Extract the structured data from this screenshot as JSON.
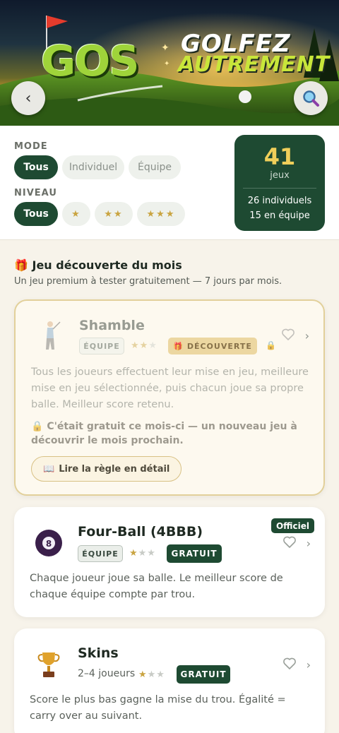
{
  "hero": {
    "logo": "GOS",
    "tagline_1": "GOLFEZ",
    "tagline_2": "AUTREMENT",
    "back_icon": "chevron-left-icon",
    "search_icon": "search-icon"
  },
  "filters": {
    "mode_label": "MODE",
    "mode_options": [
      "Tous",
      "Individuel",
      "Équipe"
    ],
    "mode_selected": "Tous",
    "level_label": "NIVEAU",
    "level_options": [
      "Tous",
      "★",
      "★★",
      "★★★"
    ],
    "level_selected": "Tous"
  },
  "summary": {
    "count": "41",
    "unit": "jeux",
    "individual": "26 individuels",
    "team": "15 en équipe"
  },
  "discovery": {
    "title": "Jeu découverte du mois",
    "subtitle": "Un jeu premium à tester gratuitement — 7 jours par mois."
  },
  "games": [
    {
      "name": "Shamble",
      "badge": "ÉQUIPE",
      "level": 2,
      "tag": "DÉCOUVERTE",
      "description": "Tous les joueurs effectuent leur mise en jeu, meilleure mise en jeu sélectionnée, puis chacun joue sa propre balle. Meilleur score retenu.",
      "notice": "C'était gratuit ce mois-ci — un nouveau jeu à découvrir le mois prochain.",
      "rule_button": "Lire la règle en détail"
    },
    {
      "name": "Four-Ball (4BBB)",
      "badge": "ÉQUIPE",
      "level": 1,
      "tag": "GRATUIT",
      "official": "Officiel",
      "description": "Chaque joueur joue sa balle. Le meilleur score de chaque équipe compte par trou."
    },
    {
      "name": "Skins",
      "players": "2–4 joueurs",
      "level": 1,
      "tag": "GRATUIT",
      "description": "Score le plus bas gagne la mise du trou. Égalité = carry over au suivant."
    }
  ],
  "colors": {
    "primary": "#1e4a32",
    "gold": "#c9a441",
    "background": "#f7f3ea"
  }
}
